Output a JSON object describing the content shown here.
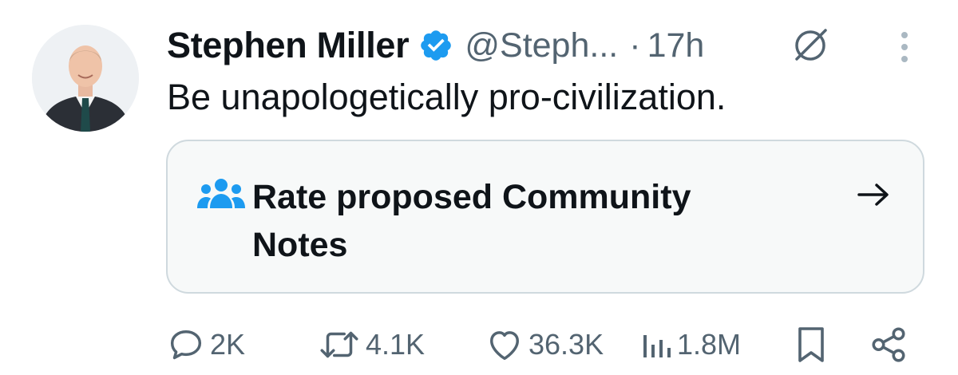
{
  "author": {
    "display_name": "Stephen Miller",
    "handle": "@Steph...",
    "separator": "·",
    "time": "17h"
  },
  "tweet": {
    "text": "Be unapologetically pro-civilization."
  },
  "community_notes": {
    "label": "Rate proposed Community Notes"
  },
  "actions": {
    "reply_count": "2K",
    "repost_count": "4.1K",
    "like_count": "36.3K",
    "views_count": "1.8M"
  },
  "colors": {
    "text_primary": "#0f1419",
    "text_secondary": "#536471",
    "verified_blue": "#1d9bf0",
    "card_bg": "#f7f9f9",
    "card_border": "#cfd9de"
  },
  "icons": {
    "verified": "verified-badge-icon",
    "grok": "grok-icon",
    "more": "more-vertical-icon",
    "community": "people-icon",
    "arrow": "arrow-right-icon",
    "reply": "reply-icon",
    "repost": "repost-icon",
    "like": "heart-icon",
    "views": "views-icon",
    "bookmark": "bookmark-icon",
    "share": "share-icon"
  }
}
